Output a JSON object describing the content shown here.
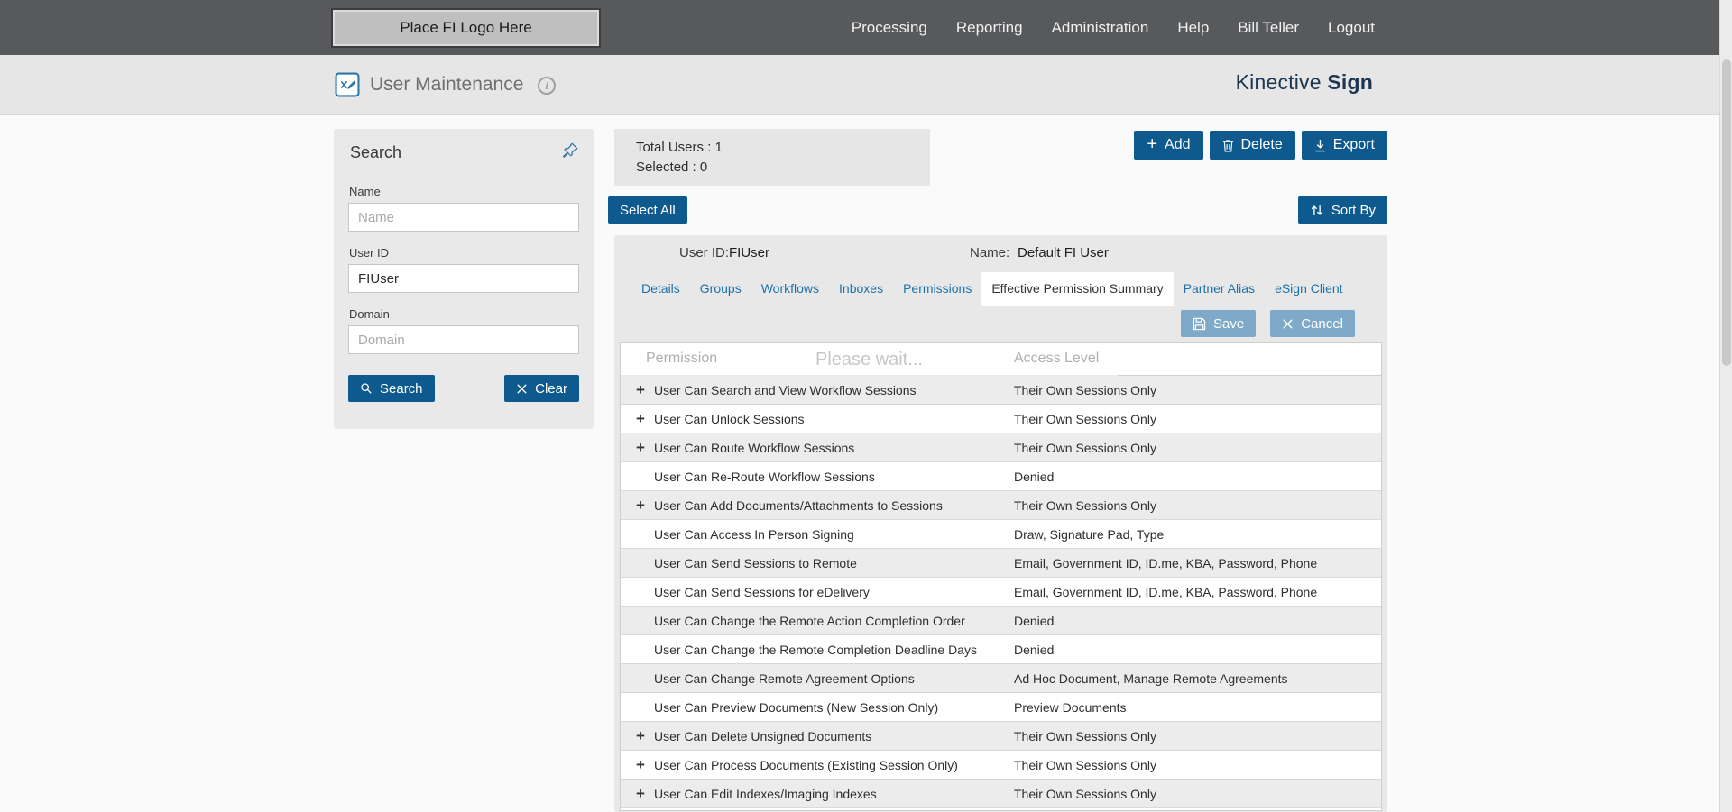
{
  "topbar": {
    "logo_placeholder": "Place FI Logo Here",
    "nav_items": [
      "Processing",
      "Reporting",
      "Administration",
      "Help",
      "Bill Teller",
      "Logout"
    ]
  },
  "header": {
    "title": "User Maintenance",
    "brand": {
      "first": "Kinective",
      "second": "Sign"
    }
  },
  "icons": {
    "add_plus": "+",
    "expand_row": "+",
    "info": "i"
  },
  "search_panel": {
    "title": "Search",
    "fields": {
      "name": {
        "label": "Name",
        "placeholder": "Name",
        "value": ""
      },
      "user_id": {
        "label": "User ID",
        "placeholder": "",
        "value": "FIUser"
      },
      "domain": {
        "label": "Domain",
        "placeholder": "Domain",
        "value": ""
      }
    },
    "search_button": "Search",
    "clear_button": "Clear"
  },
  "toolbar": {
    "total_users": "Total Users : 1",
    "selected": "Selected : 0",
    "add": "Add",
    "delete": "Delete",
    "export": "Export",
    "select_all": "Select All",
    "sort_by": "Sort By"
  },
  "user_card": {
    "user_id_label": "User ID:",
    "user_id_value": "FIUser",
    "name_label": "Name:",
    "name_value": "Default FI User",
    "tabs": [
      "Details",
      "Groups",
      "Workflows",
      "Inboxes",
      "Permissions",
      "Effective Permission Summary",
      "Partner Alias",
      "eSign Client"
    ],
    "active_tab": "Effective Permission Summary",
    "save_button": "Save",
    "cancel_button": "Cancel",
    "loading_text": "Please wait...",
    "table": {
      "columns": [
        "Permission",
        "Access Level"
      ],
      "rows": [
        {
          "expandable": true,
          "permission": "User Can Search and View Workflow Sessions",
          "access": "Their Own Sessions Only"
        },
        {
          "expandable": true,
          "permission": "User Can Unlock Sessions",
          "access": "Their Own Sessions Only"
        },
        {
          "expandable": true,
          "permission": "User Can Route Workflow Sessions",
          "access": "Their Own Sessions Only"
        },
        {
          "expandable": false,
          "permission": "User Can Re-Route Workflow Sessions",
          "access": "Denied"
        },
        {
          "expandable": true,
          "permission": "User Can Add Documents/Attachments to Sessions",
          "access": "Their Own Sessions Only"
        },
        {
          "expandable": false,
          "permission": "User Can Access In Person Signing",
          "access": "Draw, Signature Pad, Type"
        },
        {
          "expandable": false,
          "permission": "User Can Send Sessions to Remote",
          "access": "Email, Government ID, ID.me, KBA, Password, Phone"
        },
        {
          "expandable": false,
          "permission": "User Can Send Sessions for eDelivery",
          "access": "Email, Government ID, ID.me, KBA, Password, Phone"
        },
        {
          "expandable": false,
          "permission": "User Can Change the Remote Action Completion Order",
          "access": "Denied"
        },
        {
          "expandable": false,
          "permission": "User Can Change the Remote Completion Deadline Days",
          "access": "Denied"
        },
        {
          "expandable": false,
          "permission": "User Can Change Remote Agreement Options",
          "access": "Ad Hoc Document, Manage Remote Agreements"
        },
        {
          "expandable": false,
          "permission": "User Can Preview Documents (New Session Only)",
          "access": "Preview Documents"
        },
        {
          "expandable": true,
          "permission": "User Can Delete Unsigned Documents",
          "access": "Their Own Sessions Only"
        },
        {
          "expandable": true,
          "permission": "User Can Process Documents (Existing Session Only)",
          "access": "Their Own Sessions Only"
        },
        {
          "expandable": true,
          "permission": "User Can Edit Indexes/Imaging Indexes",
          "access": "Their Own Sessions Only"
        }
      ]
    }
  },
  "colors": {
    "primary_button": "#0e5a8f",
    "disabled_button": "#7fa9c9",
    "tab_text": "#1a72ad",
    "topbar_bg": "#58595b",
    "brand_text": "#1b3650"
  }
}
